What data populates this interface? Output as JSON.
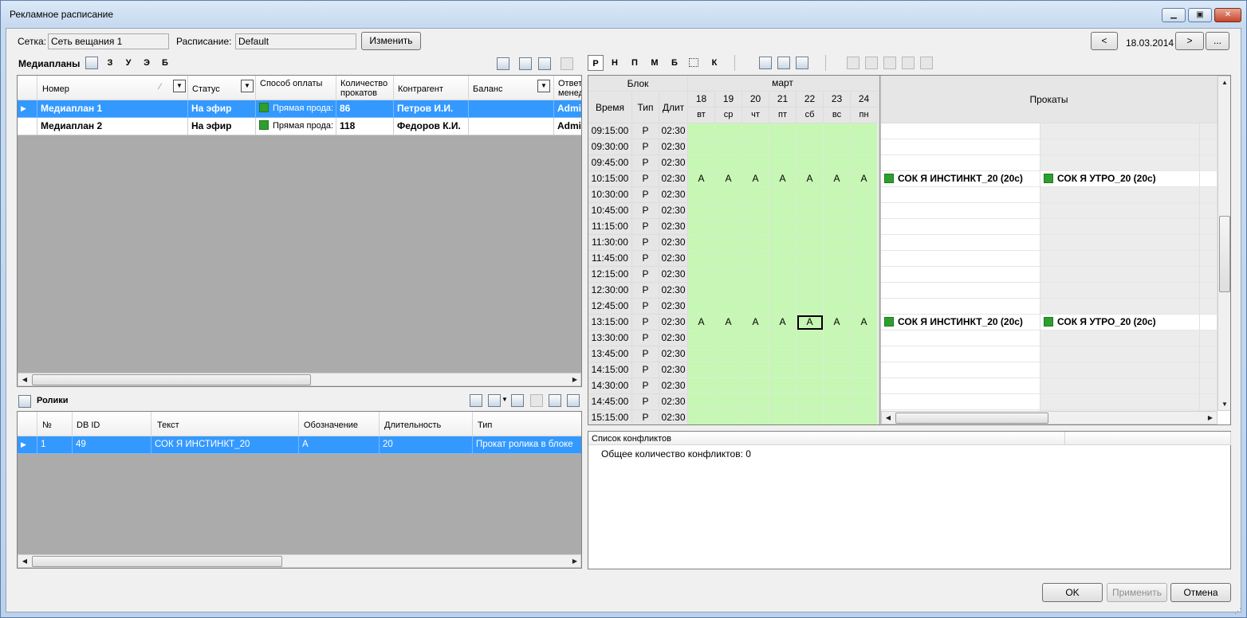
{
  "window": {
    "title": "Рекламное расписание"
  },
  "top": {
    "grid_label": "Сетка:",
    "grid_value": "Сеть вещания 1",
    "schedule_label": "Расписание:",
    "schedule_value": "Default",
    "change_button": "Изменить",
    "prev_button": "<",
    "date": "18.03.2014",
    "next_button": ">",
    "more_button": "..."
  },
  "mediaplans": {
    "label": "Медиапланы",
    "filters": [
      "З",
      "У",
      "Э",
      "Б"
    ],
    "columns": [
      "Номер",
      "Статус",
      "Способ оплаты",
      "Количество прокатов",
      "Контрагент",
      "Баланс",
      "Ответ менед"
    ],
    "rows": [
      {
        "number": "Медиаплан 1",
        "status": "На эфир",
        "payment": "Прямая прода:",
        "count": "86",
        "agent": "Петров И.И.",
        "balance": "",
        "manager": "Admin"
      },
      {
        "number": "Медиаплан 2",
        "status": "На эфир",
        "payment": "Прямая прода:",
        "count": "118",
        "agent": "Федоров К.И.",
        "balance": "",
        "manager": "Admin"
      }
    ]
  },
  "clips": {
    "label": "Ролики",
    "columns": [
      "№",
      "DB ID",
      "Текст",
      "Обозначение",
      "Длительность",
      "Тип"
    ],
    "rows": [
      {
        "n": "1",
        "dbid": "49",
        "text": "СОК Я ИНСТИНКТ_20",
        "code": "A",
        "duration": "20",
        "type": "Прокат ролика в блоке"
      }
    ]
  },
  "schedule": {
    "tabs": [
      "Р",
      "Н",
      "П",
      "М",
      "Б",
      "К"
    ],
    "header": {
      "block": "Блок",
      "time": "Время",
      "type": "Тип",
      "dur": "Длит",
      "month": "март",
      "rolls": "Прокаты"
    },
    "days": [
      {
        "d": "18",
        "w": "вт"
      },
      {
        "d": "19",
        "w": "ср"
      },
      {
        "d": "20",
        "w": "чт"
      },
      {
        "d": "21",
        "w": "пт"
      },
      {
        "d": "22",
        "w": "сб"
      },
      {
        "d": "23",
        "w": "вс"
      },
      {
        "d": "24",
        "w": "пн"
      }
    ],
    "rows": [
      {
        "time": "09:15:00",
        "type": "Р",
        "dur": "02:30",
        "marks": [
          "",
          "",
          "",
          "",
          "",
          "",
          ""
        ],
        "rolls": [
          "",
          ""
        ]
      },
      {
        "time": "09:30:00",
        "type": "Р",
        "dur": "02:30",
        "marks": [
          "",
          "",
          "",
          "",
          "",
          "",
          ""
        ],
        "rolls": [
          "",
          ""
        ]
      },
      {
        "time": "09:45:00",
        "type": "Р",
        "dur": "02:30",
        "marks": [
          "",
          "",
          "",
          "",
          "",
          "",
          ""
        ],
        "rolls": [
          "",
          ""
        ]
      },
      {
        "time": "10:15:00",
        "type": "Р",
        "dur": "02:30",
        "marks": [
          "A",
          "A",
          "A",
          "A",
          "A",
          "A",
          "A"
        ],
        "rolls": [
          "СОК Я ИНСТИНКТ_20 (20c)",
          "СОК Я УТРО_20 (20c)"
        ]
      },
      {
        "time": "10:30:00",
        "type": "Р",
        "dur": "02:30",
        "marks": [
          "",
          "",
          "",
          "",
          "",
          "",
          ""
        ],
        "rolls": [
          "",
          ""
        ]
      },
      {
        "time": "10:45:00",
        "type": "Р",
        "dur": "02:30",
        "marks": [
          "",
          "",
          "",
          "",
          "",
          "",
          ""
        ],
        "rolls": [
          "",
          ""
        ]
      },
      {
        "time": "11:15:00",
        "type": "Р",
        "dur": "02:30",
        "marks": [
          "",
          "",
          "",
          "",
          "",
          "",
          ""
        ],
        "rolls": [
          "",
          ""
        ]
      },
      {
        "time": "11:30:00",
        "type": "Р",
        "dur": "02:30",
        "marks": [
          "",
          "",
          "",
          "",
          "",
          "",
          ""
        ],
        "rolls": [
          "",
          ""
        ]
      },
      {
        "time": "11:45:00",
        "type": "Р",
        "dur": "02:30",
        "marks": [
          "",
          "",
          "",
          "",
          "",
          "",
          ""
        ],
        "rolls": [
          "",
          ""
        ]
      },
      {
        "time": "12:15:00",
        "type": "Р",
        "dur": "02:30",
        "marks": [
          "",
          "",
          "",
          "",
          "",
          "",
          ""
        ],
        "rolls": [
          "",
          ""
        ]
      },
      {
        "time": "12:30:00",
        "type": "Р",
        "dur": "02:30",
        "marks": [
          "",
          "",
          "",
          "",
          "",
          "",
          ""
        ],
        "rolls": [
          "",
          ""
        ]
      },
      {
        "time": "12:45:00",
        "type": "Р",
        "dur": "02:30",
        "marks": [
          "",
          "",
          "",
          "",
          "",
          "",
          ""
        ],
        "rolls": [
          "",
          ""
        ]
      },
      {
        "time": "13:15:00",
        "type": "Р",
        "dur": "02:30",
        "marks": [
          "A",
          "A",
          "A",
          "A",
          "A",
          "A",
          "A"
        ],
        "rolls": [
          "СОК Я ИНСТИНКТ_20 (20c)",
          "СОК Я УТРО_20 (20c)"
        ]
      },
      {
        "time": "13:30:00",
        "type": "Р",
        "dur": "02:30",
        "marks": [
          "",
          "",
          "",
          "",
          "",
          "",
          ""
        ],
        "rolls": [
          "",
          ""
        ]
      },
      {
        "time": "13:45:00",
        "type": "Р",
        "dur": "02:30",
        "marks": [
          "",
          "",
          "",
          "",
          "",
          "",
          ""
        ],
        "rolls": [
          "",
          ""
        ]
      },
      {
        "time": "14:15:00",
        "type": "Р",
        "dur": "02:30",
        "marks": [
          "",
          "",
          "",
          "",
          "",
          "",
          ""
        ],
        "rolls": [
          "",
          ""
        ]
      },
      {
        "time": "14:30:00",
        "type": "Р",
        "dur": "02:30",
        "marks": [
          "",
          "",
          "",
          "",
          "",
          "",
          ""
        ],
        "rolls": [
          "",
          ""
        ]
      },
      {
        "time": "14:45:00",
        "type": "Р",
        "dur": "02:30",
        "marks": [
          "",
          "",
          "",
          "",
          "",
          "",
          ""
        ],
        "rolls": [
          "",
          ""
        ]
      },
      {
        "time": "15:15:00",
        "type": "Р",
        "dur": "02:30",
        "marks": [
          "",
          "",
          "",
          "",
          "",
          "",
          ""
        ],
        "rolls": [
          "",
          ""
        ]
      }
    ]
  },
  "conflicts": {
    "header": "Список конфликтов",
    "total": "Общее количество конфликтов: 0"
  },
  "footer": {
    "ok": "OK",
    "apply": "Применить",
    "cancel": "Отмена"
  },
  "colors": {
    "selection": "#3399ff",
    "block_green": "#c6f7b4",
    "marker_green": "#2e9e2e"
  }
}
